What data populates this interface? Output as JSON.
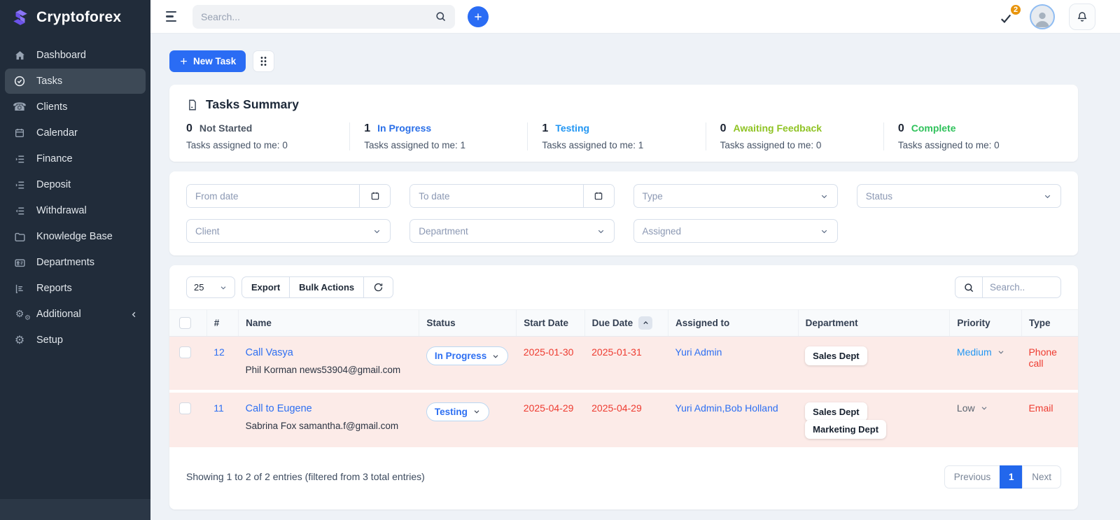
{
  "brand": {
    "name": "Cryptoforex",
    "logo_color": "#7a64f0"
  },
  "topbar": {
    "search_placeholder": "Search...",
    "badge_count": "2"
  },
  "sidebar": {
    "items": [
      {
        "label": "Dashboard",
        "icon": "home-icon",
        "active": false
      },
      {
        "label": "Tasks",
        "icon": "check-circle-icon",
        "active": true
      },
      {
        "label": "Clients",
        "icon": "phone-icon",
        "active": false
      },
      {
        "label": "Calendar",
        "icon": "calendar-icon",
        "active": false
      },
      {
        "label": "Finance",
        "icon": "list-indent-icon",
        "active": false
      },
      {
        "label": "Deposit",
        "icon": "list-indent-icon",
        "active": false
      },
      {
        "label": "Withdrawal",
        "icon": "list-arrow-left-icon",
        "active": false
      },
      {
        "label": "Knowledge Base",
        "icon": "folder-icon",
        "active": false
      },
      {
        "label": "Departments",
        "icon": "id-card-icon",
        "active": false
      },
      {
        "label": "Reports",
        "icon": "report-icon",
        "active": false
      },
      {
        "label": "Additional",
        "icon": "gears-icon",
        "active": false,
        "has_submenu": true
      },
      {
        "label": "Setup",
        "icon": "gear-icon",
        "active": false
      }
    ]
  },
  "actions": {
    "new_task": "New Task"
  },
  "summary": {
    "title": "Tasks Summary",
    "items": [
      {
        "count": "0",
        "label": "Not Started",
        "color": "#4b5563",
        "assigned": "Tasks assigned to me: 0"
      },
      {
        "count": "1",
        "label": "In Progress",
        "color": "#2a6fe8",
        "assigned": "Tasks assigned to me: 1"
      },
      {
        "count": "1",
        "label": "Testing",
        "color": "#2196f3",
        "assigned": "Tasks assigned to me: 1"
      },
      {
        "count": "0",
        "label": "Awaiting Feedback",
        "color": "#8fc324",
        "assigned": "Tasks assigned to me: 0"
      },
      {
        "count": "0",
        "label": "Complete",
        "color": "#2fc25b",
        "assigned": "Tasks assigned to me: 0"
      }
    ]
  },
  "filters": {
    "from_date": "From date",
    "to_date": "To date",
    "type": "Type",
    "status": "Status",
    "client": "Client",
    "department": "Department",
    "assigned": "Assigned"
  },
  "table_controls": {
    "page_size": "25",
    "export": "Export",
    "bulk_actions": "Bulk Actions",
    "search_placeholder": "Search.."
  },
  "table": {
    "headers": [
      "#",
      "Name",
      "Status",
      "Start Date",
      "Due Date",
      "Assigned to",
      "Department",
      "Priority",
      "Type"
    ],
    "rows": [
      {
        "id": "12",
        "name": "Call Vasya",
        "contact": "Phil Korman news53904@gmail.com",
        "status": "In Progress",
        "start_date": "2025-01-30",
        "due_date": "2025-01-31",
        "assigned_to": "Yuri Admin",
        "departments": [
          "Sales Dept"
        ],
        "priority": "Medium",
        "priority_color": "#2196f3",
        "type": "Phone call"
      },
      {
        "id": "11",
        "name": "Call to Eugene",
        "contact": "Sabrina Fox samantha.f@gmail.com",
        "status": "Testing",
        "start_date": "2025-04-29",
        "due_date": "2025-04-29",
        "assigned_to": "Yuri Admin,Bob Holland",
        "departments": [
          "Sales Dept",
          "Marketing Dept"
        ],
        "priority": "Low",
        "priority_color": "#5b6470",
        "type": "Email"
      }
    ]
  },
  "footer": {
    "showing": "Showing 1 to 2 of 2 entries (filtered from 3 total entries)",
    "pagination": {
      "previous": "Previous",
      "page": "1",
      "next": "Next"
    }
  }
}
